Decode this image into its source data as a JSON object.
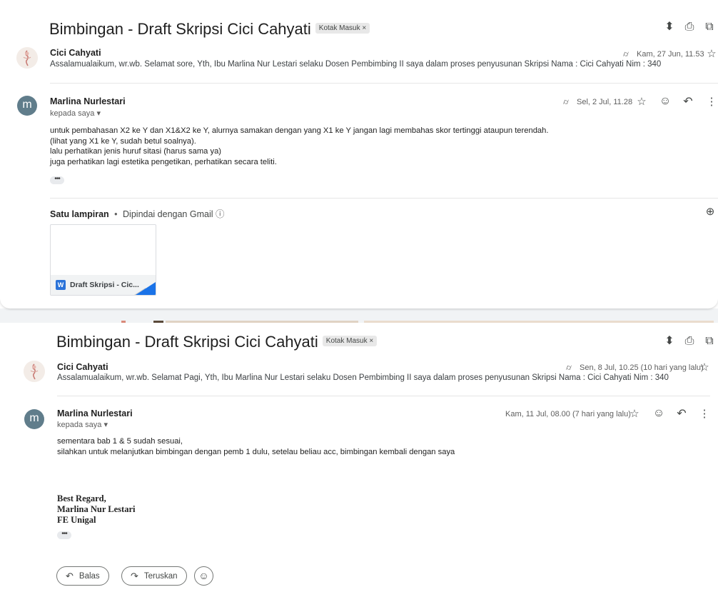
{
  "thread1": {
    "subject": "Bimbingan - Draft Skripsi Cici Cahyati",
    "label": "Kotak Masuk",
    "label_close": "×",
    "msg1": {
      "sender": "Cici Cahyati",
      "snippet": "Assalamualaikum, wr.wb. Selamat sore, Yth, Ibu Marlina Nur Lestari selaku Dosen Pembimbing II saya dalam proses penyusunan Skripsi Nama : Cici Cahyati Nim : 340",
      "date": "Kam, 27 Jun, 11.53"
    },
    "msg2": {
      "avatar_letter": "m",
      "sender": "Marlina Nurlestari",
      "to": "kepada saya",
      "date": "Sel, 2 Jul, 11.28",
      "body": [
        "untuk pembahasan X2 ke Y dan X1&X2 ke Y, alurnya samakan dengan yang X1 ke Y jangan lagi membahas skor tertinggi ataupun terendah.",
        "(lihat yang X1 ke Y, sudah betul soalnya).",
        "lalu perhatikan jenis huruf sitasi (harus sama ya)",
        "juga perhatikan lagi estetika pengetikan, perhatikan secara teliti."
      ],
      "attachments_title": "Satu lampiran",
      "scanned": "Dipindai dengan Gmail",
      "attachment_name": "Draft Skripsi - Cic..."
    }
  },
  "thread2": {
    "subject": "Bimbingan - Draft Skripsi Cici Cahyati",
    "label": "Kotak Masuk",
    "label_close": "×",
    "msg1": {
      "sender": "Cici Cahyati",
      "snippet": "Assalamualaikum, wr.wb. Selamat Pagi, Yth, Ibu Marlina Nur Lestari selaku Dosen Pembimbing II saya dalam proses penyusunan Skripsi Nama : Cici Cahyati Nim : 340",
      "date": "Sen, 8 Jul, 10.25 (10 hari yang lalu)"
    },
    "msg2": {
      "avatar_letter": "m",
      "sender": "Marlina Nurlestari",
      "to": "kepada saya",
      "date": "Kam, 11 Jul, 08.00 (7 hari yang lalu)",
      "body": [
        "sementara bab 1 & 5 sudah sesuai,",
        "silahkan untuk melanjutkan bimbingan dengan pemb 1 dulu, setelau beliau acc, bimbingan kembali dengan saya"
      ],
      "signature": [
        "Best Regard,",
        "Marlina Nur Lestari",
        "FE Unigal"
      ]
    },
    "actions": {
      "reply": "Balas",
      "forward": "Teruskan"
    }
  },
  "icons": {
    "expand": "⬍",
    "print": "⎙",
    "open_new": "⧉",
    "star": "☆",
    "emoji": "☺",
    "reply": "↶",
    "forward": "↷",
    "more": "⋮",
    "attachment": "⌭",
    "info": "ⓘ",
    "drive_add": "⊕",
    "dots": "•••",
    "dropdown": "▾",
    "bullet": "•"
  },
  "colors": {
    "avatar": "#607d8b",
    "word_badge": "#2b73d9",
    "accent": "#1a73e8"
  }
}
